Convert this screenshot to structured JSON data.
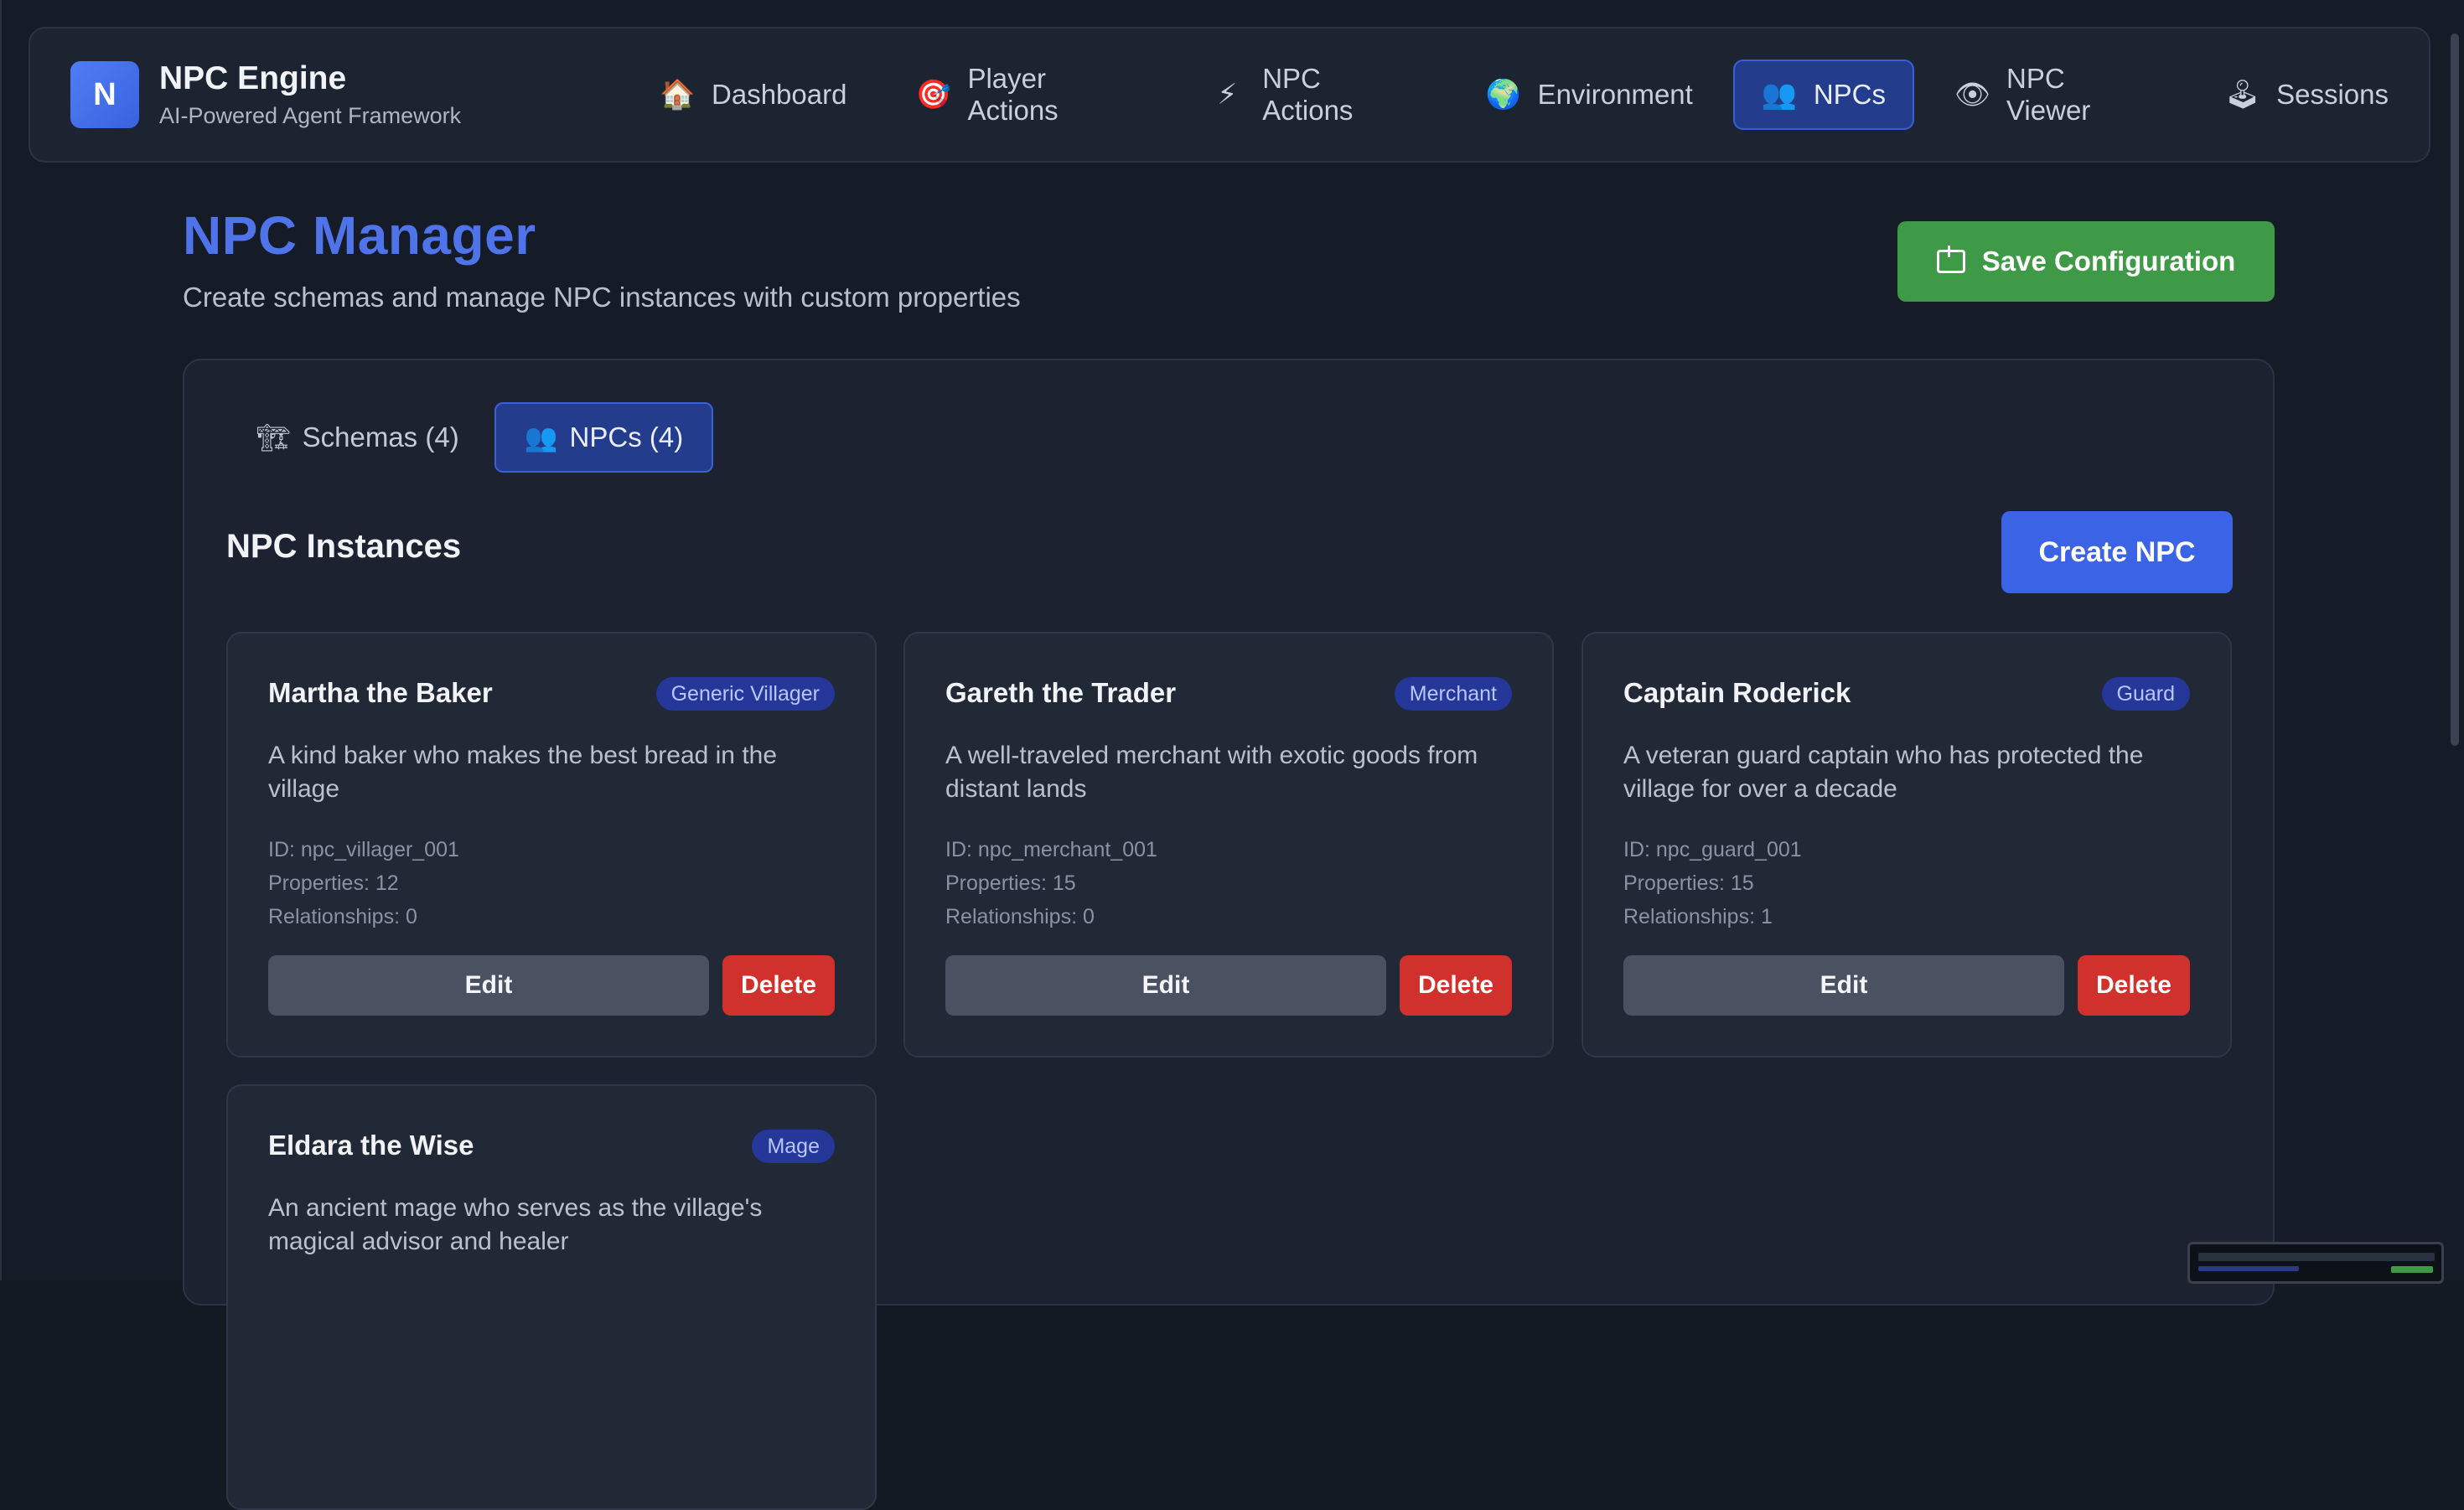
{
  "app": {
    "logo_letter": "N",
    "name": "NPC Engine",
    "subtitle": "AI-Powered Agent Framework"
  },
  "nav": {
    "items": [
      {
        "label": "Dashboard",
        "icon": "house-icon",
        "glyph": "🏠",
        "active": false
      },
      {
        "label": "Player Actions",
        "icon": "target-icon",
        "glyph": "🎯",
        "active": false
      },
      {
        "label": "NPC Actions",
        "icon": "lightning-icon",
        "glyph": "⚡",
        "active": false
      },
      {
        "label": "Environment",
        "icon": "globe-icon",
        "glyph": "🌍",
        "active": false
      },
      {
        "label": "NPCs",
        "icon": "people-icon",
        "glyph": "👥",
        "active": true
      },
      {
        "label": "NPC Viewer",
        "icon": "eye-icon",
        "glyph": "👁",
        "active": false
      },
      {
        "label": "Sessions",
        "icon": "joystick-icon",
        "glyph": "🕹",
        "active": false
      }
    ]
  },
  "page": {
    "title": "NPC Manager",
    "subtitle": "Create schemas and manage NPC instances with custom properties",
    "save_label": "Save Configuration"
  },
  "tabs": [
    {
      "label": "Schemas (4)",
      "icon": "construction-icon",
      "glyph": "🏗",
      "active": false
    },
    {
      "label": "NPCs (4)",
      "icon": "people-icon",
      "glyph": "👥",
      "active": true
    }
  ],
  "section": {
    "title": "NPC Instances",
    "create_label": "Create NPC"
  },
  "npcs": [
    {
      "name": "Martha the Baker",
      "badge": "Generic Villager",
      "description": "A kind baker who makes the best bread in the village",
      "id": "ID: npc_villager_001",
      "properties": "Properties: 12",
      "relationships": "Relationships: 0",
      "edit": "Edit",
      "delete": "Delete"
    },
    {
      "name": "Gareth the Trader",
      "badge": "Merchant",
      "description": "A well-traveled merchant with exotic goods from distant lands",
      "id": "ID: npc_merchant_001",
      "properties": "Properties: 15",
      "relationships": "Relationships: 0",
      "edit": "Edit",
      "delete": "Delete"
    },
    {
      "name": "Captain Roderick",
      "badge": "Guard",
      "description": "A veteran guard captain who has protected the village for over a decade",
      "id": "ID: npc_guard_001",
      "properties": "Properties: 15",
      "relationships": "Relationships: 1",
      "edit": "Edit",
      "delete": "Delete"
    },
    {
      "name": "Eldara the Wise",
      "badge": "Mage",
      "description": "An ancient mage who serves as the village's magical advisor and healer",
      "id": "",
      "properties": "",
      "relationships": "",
      "edit": "",
      "delete": ""
    }
  ]
}
